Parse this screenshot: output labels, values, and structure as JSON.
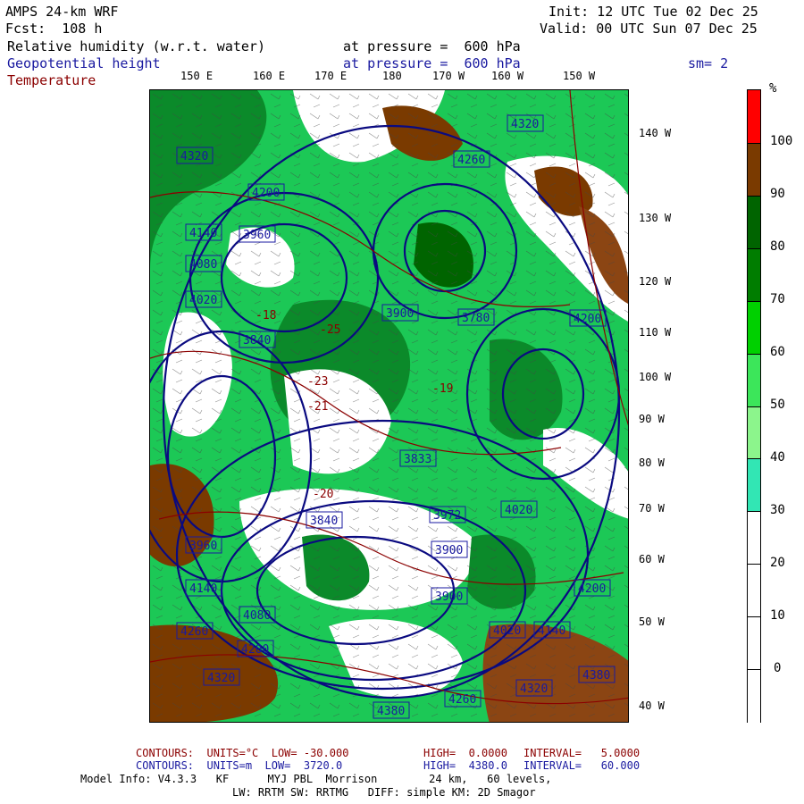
{
  "header": {
    "model": "AMPS 24-km WRF",
    "fcst": "Fcst:  108 h",
    "init": "Init: 12 UTC Tue 02 Dec 25",
    "valid": "Valid: 00 UTC Sun 07 Dec 25"
  },
  "fields": [
    {
      "name": "Relative humidity (w.r.t. water)",
      "level": "at pressure =  600 hPa",
      "color": "#000000"
    },
    {
      "name": "Geopotential height",
      "level": "at pressure =  600 hPa",
      "color": "#1a1aa0"
    },
    {
      "name": "Temperature",
      "level": "at pressure =  600 hPa",
      "color": "#8b0000"
    }
  ],
  "smoothing": "sm= 2",
  "lon_labels_top": [
    "150 E",
    "160 E",
    "170 E",
    "180",
    "170 W",
    "160 W",
    "150 W"
  ],
  "lon_labels_right": [
    "140 W",
    "130 W",
    "120 W",
    "110 W",
    "100 W",
    "90 W",
    "80 W",
    "70 W",
    "60 W",
    "50 W",
    "40 W"
  ],
  "height_labels": [
    "4320",
    "4200",
    "4140",
    "4080",
    "4020",
    "3960",
    "3900",
    "3840",
    "3833",
    "3780",
    "3972",
    "3960",
    "3900",
    "4260",
    "4320",
    "4380",
    "4140",
    "4200",
    "4080",
    "4020",
    "4260",
    "4320",
    "4200",
    "4140",
    "4200",
    "4320",
    "4380",
    "4260",
    "3900",
    "3840",
    "4020"
  ],
  "temp_labels": [
    "-25",
    "-21",
    "-19",
    "-18",
    "-23",
    "-20"
  ],
  "colorbar": {
    "unit": "%",
    "ticks": [
      "100",
      "90",
      "80",
      "70",
      "60",
      "50",
      "40",
      "30",
      "20",
      "10",
      "0"
    ],
    "colors": [
      "#ff0000",
      "#7a3a00",
      "#006400",
      "#007d00",
      "#00d000",
      "#3ce65a",
      "#8cf58c",
      "#32e6b4",
      "#ffffff",
      "#ffffff",
      "#ffffff",
      "#ffffff"
    ]
  },
  "footer": {
    "c1_label": "CONTOURS:  UNITS=°C  LOW= -30.000",
    "c1_high": "HIGH=  0.0000",
    "c1_int": "INTERVAL=   5.0000",
    "c2_label": "CONTOURS:  UNITS=m  LOW=  3720.0",
    "c2_high": "HIGH=  4380.0",
    "c2_int": "INTERVAL=   60.000",
    "model_info": "Model Info: V4.3.3   KF      MYJ PBL  Morrison        24 km,   60 levels,",
    "model_info2": "LW: RRTM SW: RRTMG   DIFF: simple KM: 2D Smagor"
  }
}
